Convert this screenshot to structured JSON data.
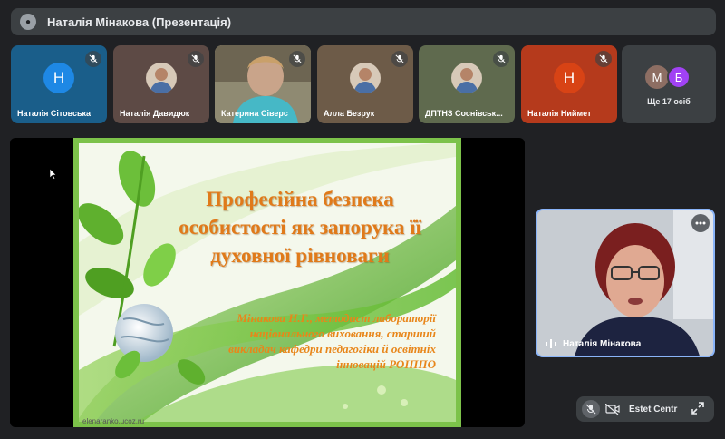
{
  "header": {
    "title": "Наталія Мінакова (Презентація)"
  },
  "tiles": [
    {
      "name": "Наталія Сітовська",
      "initial": "Н",
      "bg": "#1a5e8a",
      "circle": "#1e88e5",
      "type": "initial"
    },
    {
      "name": "Наталія Давидюк",
      "bg": "#5d4a45",
      "type": "photo"
    },
    {
      "name": "Катерина Сіверс",
      "bg": "#8a8f7a",
      "type": "video"
    },
    {
      "name": "Алла Безрук",
      "bg": "#6d5b48",
      "type": "photo"
    },
    {
      "name": "ДПТНЗ Соснівськ...",
      "bg": "#5f6a4e",
      "type": "photo"
    },
    {
      "name": "Наталія Ниймет",
      "initial": "Н",
      "bg": "#b53a1c",
      "circle": "#d84315",
      "type": "initial"
    }
  ],
  "more": {
    "av1": "М",
    "av2": "Б",
    "label": "Ще 17 осіб"
  },
  "slide": {
    "title_lines": [
      "Професійна безпека",
      "особистості як запорука її",
      "духовної рівноваги"
    ],
    "author_lines": [
      "Мінакова Н.Г., методист лабораторії",
      "національного виховання, старший",
      "викладач кафедри педагогіки й освітніх",
      "інновацій РОІППО"
    ],
    "url": "elenaranko.ucoz.ru"
  },
  "self": {
    "name": "Наталія Мінакова"
  },
  "pill": {
    "label": "Estet Centr"
  }
}
